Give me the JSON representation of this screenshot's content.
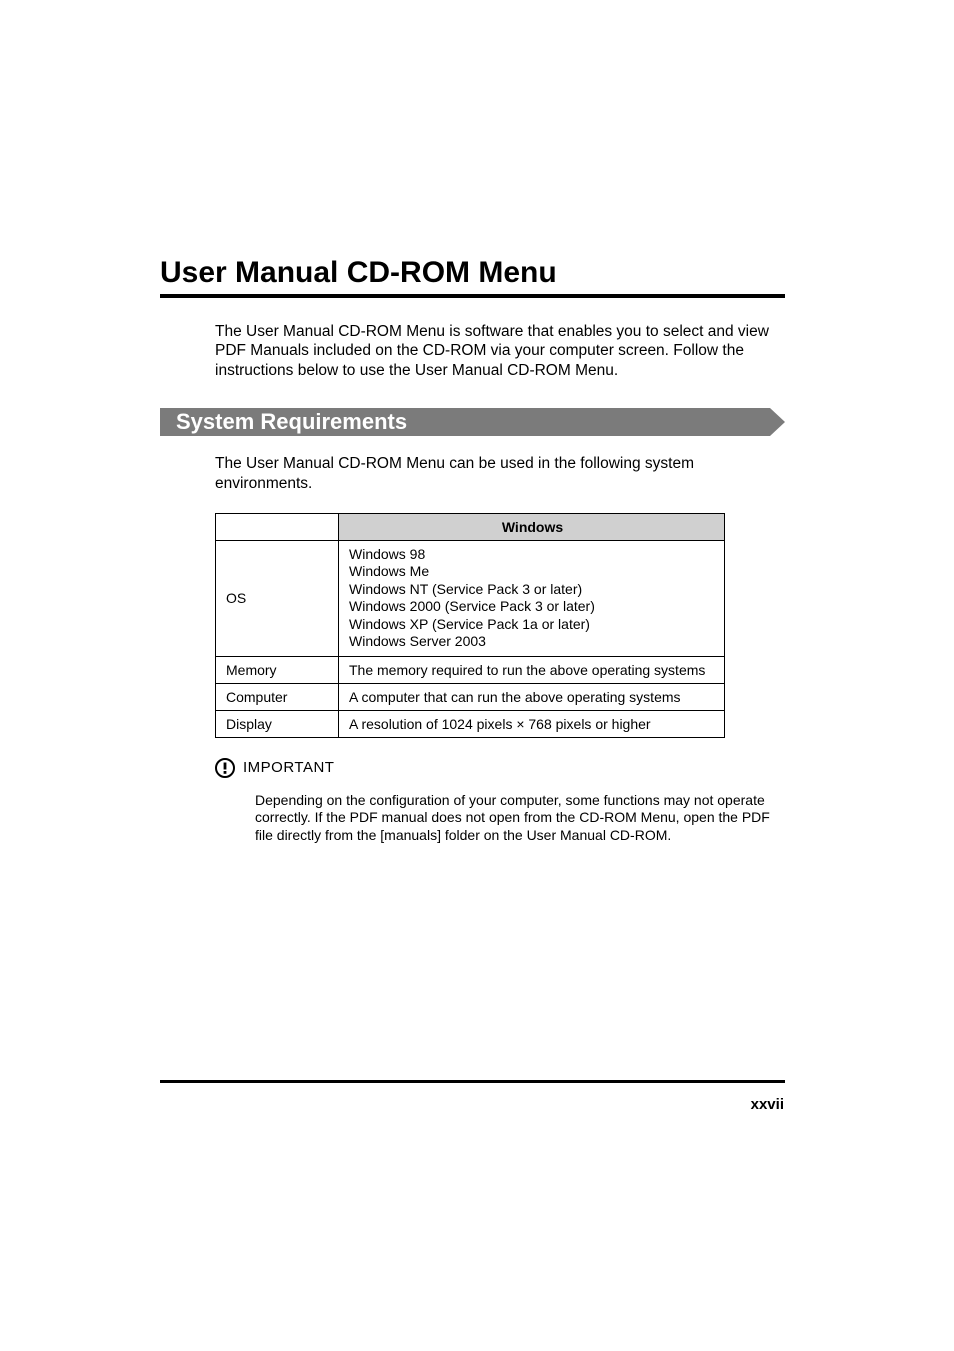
{
  "heading": "User Manual CD-ROM Menu",
  "intro": "The User Manual CD-ROM Menu is software that enables you to select and view PDF Manuals included on the CD-ROM via your computer screen. Follow the instructions below to use the User Manual CD-ROM Menu.",
  "section": {
    "title": "System Requirements",
    "intro": "The User Manual CD-ROM Menu can be used in the following system environments."
  },
  "table": {
    "col_header": "Windows",
    "rows": {
      "os": {
        "label": "OS",
        "lines": [
          "Windows 98",
          "Windows Me",
          "Windows NT (Service Pack 3 or later)",
          "Windows 2000 (Service Pack 3 or later)",
          "Windows XP (Service Pack 1a or later)",
          "Windows Server 2003"
        ]
      },
      "memory": {
        "label": "Memory",
        "value": "The memory required to run the above operating systems"
      },
      "computer": {
        "label": "Computer",
        "value": "A computer that can run the above operating systems"
      },
      "display": {
        "label": "Display",
        "value": "A resolution of 1024 pixels × 768 pixels or higher"
      }
    }
  },
  "important": {
    "label": "IMPORTANT",
    "text": "Depending on the configuration of your computer, some functions may not operate correctly. If the PDF manual does not open from the CD-ROM Menu, open the PDF file directly from the [manuals] folder on the User Manual CD-ROM."
  },
  "page_number": "xxvii"
}
